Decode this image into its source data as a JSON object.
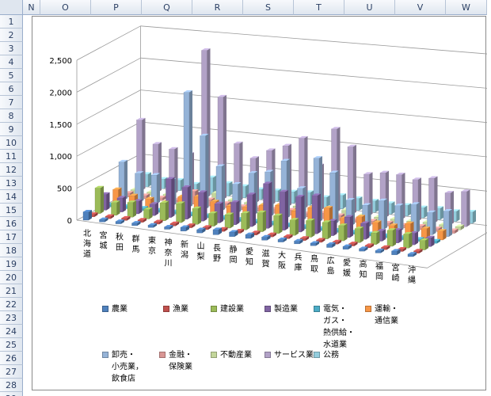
{
  "spreadsheet": {
    "columns": [
      "N",
      "O",
      "P",
      "Q",
      "R",
      "S",
      "T",
      "U",
      "V",
      "W"
    ],
    "rows": [
      "1",
      "2",
      "3",
      "4",
      "5",
      "6",
      "7",
      "8",
      "9",
      "10",
      "11",
      "12",
      "13",
      "14",
      "15",
      "16",
      "17",
      "18",
      "19",
      "20",
      "21",
      "22",
      "23",
      "24",
      "25",
      "26",
      "27",
      "28",
      "29"
    ]
  },
  "chart_data": {
    "type": "bar",
    "subtype": "3d-column",
    "title": "",
    "xlabel": "",
    "ylabel": "",
    "ylim": [
      0,
      2500
    ],
    "yticks": [
      "0",
      "500",
      "1,000",
      "1,500",
      "2,000",
      "2,500"
    ],
    "grid": true,
    "legend_position": "bottom",
    "categories": [
      "北海道",
      "宮城",
      "秋田",
      "群馬",
      "東京",
      "神奈川",
      "新潟",
      "山梨",
      "長野",
      "静岡",
      "愛知",
      "滋賀",
      "大阪",
      "兵庫",
      "鳥取",
      "広島",
      "愛媛",
      "高知",
      "福岡",
      "宮崎",
      "沖縄"
    ],
    "series": [
      {
        "name": "農業",
        "color": "#4f81bd",
        "values": [
          130,
          40,
          35,
          40,
          30,
          30,
          60,
          50,
          80,
          70,
          60,
          50,
          40,
          45,
          40,
          50,
          45,
          40,
          35,
          60,
          40
        ]
      },
      {
        "name": "漁業",
        "color": "#c0504d",
        "values": [
          40,
          20,
          15,
          10,
          10,
          15,
          20,
          15,
          15,
          25,
          20,
          10,
          10,
          15,
          20,
          20,
          25,
          20,
          20,
          25,
          20
        ]
      },
      {
        "name": "建設業",
        "color": "#9bbb59",
        "values": [
          400,
          200,
          230,
          150,
          280,
          300,
          250,
          200,
          210,
          260,
          300,
          280,
          240,
          260,
          260,
          240,
          220,
          180,
          250,
          220,
          150
        ]
      },
      {
        "name": "製造業",
        "color": "#8064a2",
        "values": [
          250,
          220,
          200,
          180,
          600,
          500,
          450,
          300,
          350,
          500,
          700,
          600,
          550,
          600,
          230,
          320,
          250,
          160,
          200,
          180,
          140
        ]
      },
      {
        "name": "電気・ガス・熱供給・水道業",
        "color": "#4bacc6",
        "values": [
          30,
          25,
          20,
          25,
          40,
          30,
          30,
          25,
          25,
          30,
          35,
          30,
          35,
          30,
          25,
          30,
          30,
          25,
          30,
          25,
          25
        ]
      },
      {
        "name": "運輸・通信業",
        "color": "#f79646",
        "values": [
          220,
          150,
          130,
          110,
          220,
          250,
          200,
          160,
          170,
          230,
          260,
          200,
          280,
          300,
          170,
          220,
          160,
          140,
          200,
          150,
          140
        ]
      },
      {
        "name": "卸売・小売業，飲食店",
        "color": "#95b3d7",
        "values": [
          600,
          450,
          450,
          400,
          1800,
          1150,
          700,
          450,
          650,
          700,
          900,
          500,
          1000,
          800,
          400,
          350,
          450,
          400,
          450,
          350,
          400
        ]
      },
      {
        "name": "金融・保険業",
        "color": "#d99694",
        "values": [
          60,
          50,
          45,
          40,
          200,
          100,
          70,
          50,
          60,
          70,
          80,
          55,
          90,
          80,
          45,
          50,
          50,
          45,
          55,
          45,
          45
        ]
      },
      {
        "name": "不動産業",
        "color": "#c3d69b",
        "values": [
          60,
          50,
          45,
          45,
          100,
          150,
          70,
          60,
          65,
          70,
          90,
          60,
          120,
          110,
          55,
          60,
          60,
          55,
          65,
          55,
          55
        ]
      },
      {
        "name": "サービス業",
        "color": "#b2a2c7",
        "values": [
          1100,
          750,
          700,
          650,
          2300,
          1600,
          900,
          700,
          850,
          950,
          1100,
          700,
          1300,
          1050,
          650,
          700,
          700,
          650,
          700,
          500,
          550
        ]
      },
      {
        "name": "公務",
        "color": "#93cddd",
        "values": [
          200,
          150,
          160,
          130,
          260,
          200,
          180,
          160,
          170,
          180,
          200,
          150,
          210,
          190,
          180,
          170,
          170,
          160,
          180,
          160,
          180
        ]
      }
    ]
  }
}
